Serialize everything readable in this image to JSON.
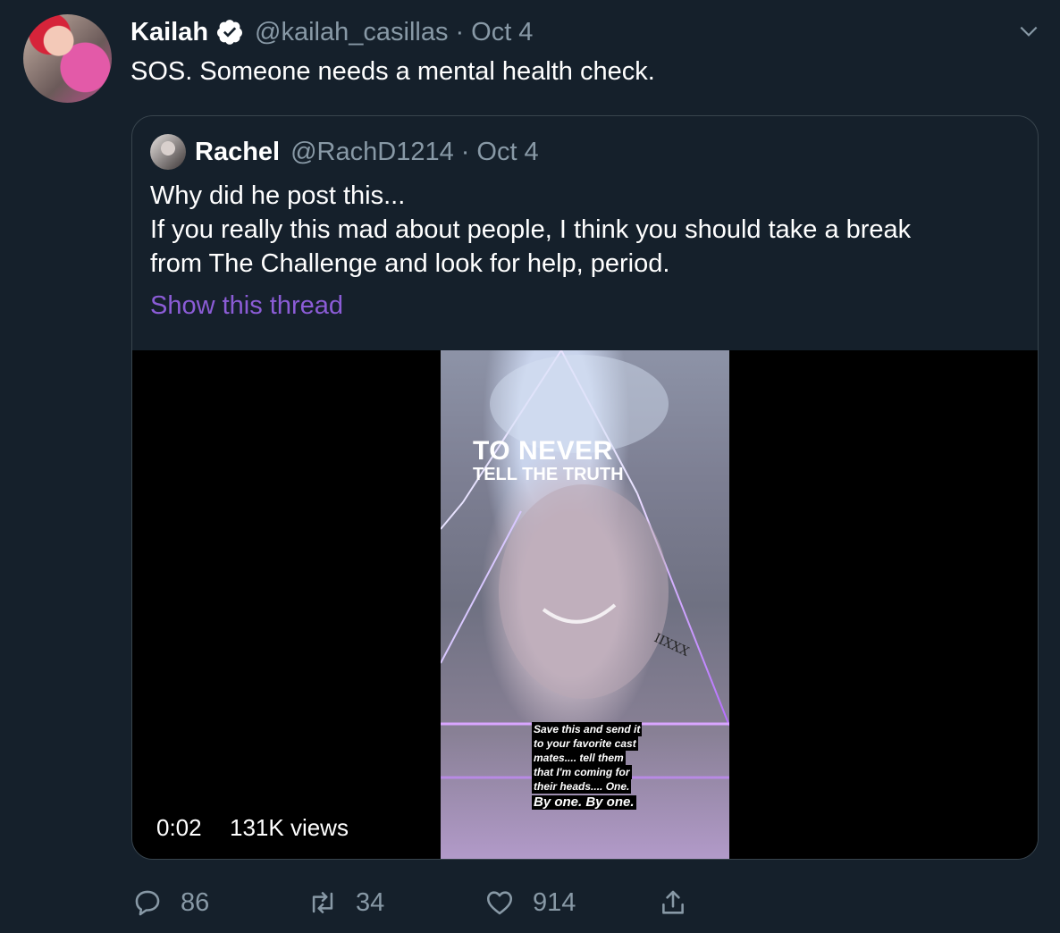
{
  "tweet": {
    "author": {
      "name": "Kailah",
      "handle": "@kailah_casillas",
      "verified": true,
      "avatar_icon": "profile-avatar"
    },
    "separator": "·",
    "date": "Oct 4",
    "text": "SOS. Someone needs a mental health check.",
    "menu_icon": "chevron-down-icon"
  },
  "quote": {
    "author": {
      "name": "Rachel",
      "handle": "@RachD1214"
    },
    "separator": "·",
    "date": "Oct 4",
    "lines": [
      "Why did he post this...",
      "If you really this mad about people, I think you should take a break",
      "from The Challenge and look for help, period."
    ],
    "show_thread": "Show this thread",
    "video": {
      "overlay_title": "TO NEVER",
      "overlay_subtitle": "TELL THE TRUTH",
      "caption_lines": [
        "Save this and send it",
        "to your favorite cast",
        "mates.... tell them",
        "that I'm coming for",
        "their heads.... One.",
        "By one. By one."
      ],
      "duration": "0:02",
      "views": "131K views"
    }
  },
  "actions": {
    "reply_count": "86",
    "retweet_count": "34",
    "like_count": "914"
  },
  "colors": {
    "background": "#15202b",
    "secondary_text": "#8899a6",
    "link": "#8b5cd6",
    "border": "#38444d"
  }
}
